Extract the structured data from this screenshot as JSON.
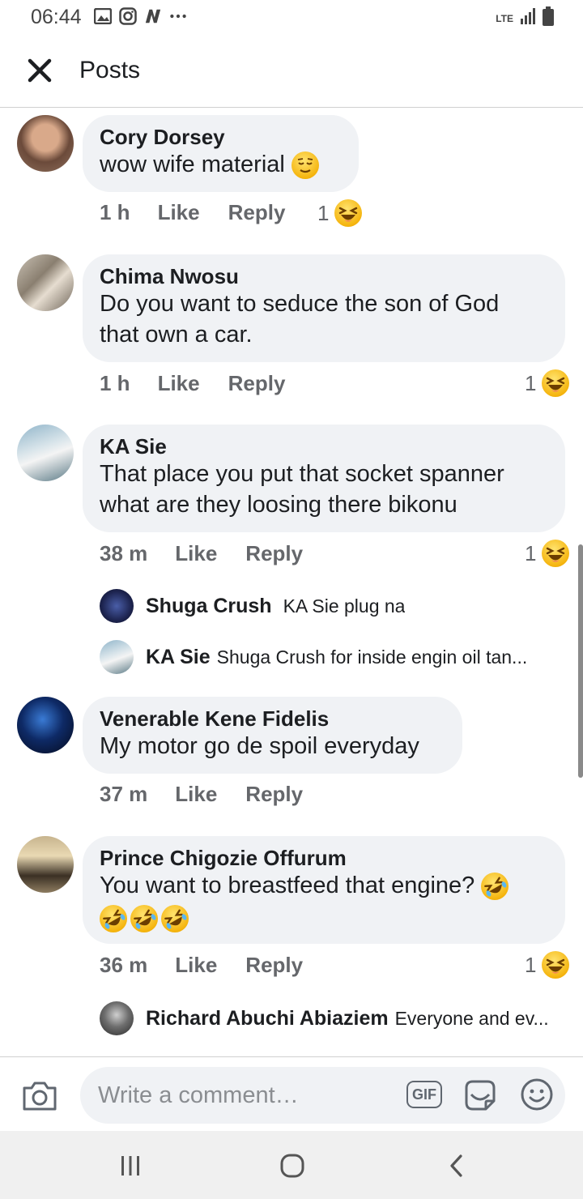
{
  "status_bar": {
    "time": "06:44",
    "network": "LTE",
    "icons": [
      "gallery-icon",
      "instagram-icon",
      "n-app-icon",
      "more-dots-icon",
      "signal-icon",
      "battery-icon"
    ]
  },
  "header": {
    "title": "Posts",
    "close_icon": "close-icon"
  },
  "comments": [
    {
      "author": "Cory Dorsey",
      "text": "wow wife material",
      "time": "1 h",
      "like": "Like",
      "reply": "Reply",
      "reaction_count": "1",
      "reaction": "laughing-emoji"
    },
    {
      "author": "Chima Nwosu",
      "text_line1": "Do you want to seduce the son of God",
      "text_line2": "that own a car.",
      "time": "1 h",
      "like": "Like",
      "reply": "Reply",
      "reaction_count": "1",
      "reaction": "laughing-emoji"
    },
    {
      "author": "KA Sie",
      "text_line1": "That place you put that socket spanner",
      "text_line2": "what are they loosing there bikonu",
      "time": "38 m",
      "like": "Like",
      "reply": "Reply",
      "reaction_count": "1",
      "reaction": "laughing-emoji",
      "replies": [
        {
          "author": "Shuga Crush",
          "text": "KA Sie plug na"
        },
        {
          "author": "KA Sie",
          "text": "Shuga Crush for inside engin oil tan..."
        }
      ]
    },
    {
      "author": "Venerable Kene Fidelis",
      "text": "My motor go de spoil everyday",
      "time": "37 m",
      "like": "Like",
      "reply": "Reply"
    },
    {
      "author": "Prince Chigozie Offurum",
      "text": "You want to breastfeed that engine?",
      "time": "36 m",
      "like": "Like",
      "reply": "Reply",
      "reaction_count": "1",
      "reaction": "laughing-emoji",
      "replies": [
        {
          "author": "Richard Abuchi Abiaziem",
          "text": "Everyone and ev..."
        }
      ]
    }
  ],
  "composer": {
    "placeholder": "Write a comment…",
    "gif_label": "GIF"
  },
  "colors": {
    "bubble": "#f0f2f5",
    "meta_text": "#65676b",
    "text": "#1c1e21"
  }
}
